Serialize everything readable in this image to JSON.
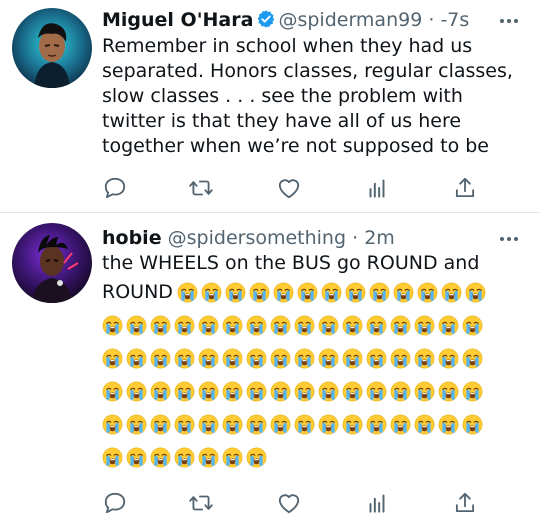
{
  "tweets": [
    {
      "name": "Miguel O'Hara",
      "handle": "@spiderman99",
      "separator": "·",
      "time": "-7s",
      "verified": true,
      "lines": [
        "Remember in school when they had us",
        "separated. Honors classes, regular classes,",
        "slow classes . . . see the problem with",
        "twitter is that they have all of us here",
        "together when we’re not supposed to be"
      ]
    },
    {
      "name": "hobie",
      "handle": "@spidersomething",
      "separator": "·",
      "time": "2m",
      "verified": false,
      "lines": [
        "the WHEELS on the BUS go ROUND and",
        "ROUND"
      ],
      "emoji_name": "loudly-crying-face",
      "emoji_counts": {
        "inline": 13,
        "row1": 16,
        "row2": 16,
        "row3": 16,
        "row4": 16,
        "row5": 7
      }
    }
  ],
  "icons": {
    "actions": [
      "reply-icon",
      "retweet-icon",
      "like-icon",
      "analytics-icon",
      "share-icon"
    ],
    "colors": {
      "icon": "#536471",
      "verified": "#1d9bf0",
      "emoji": "#ffca28"
    }
  }
}
